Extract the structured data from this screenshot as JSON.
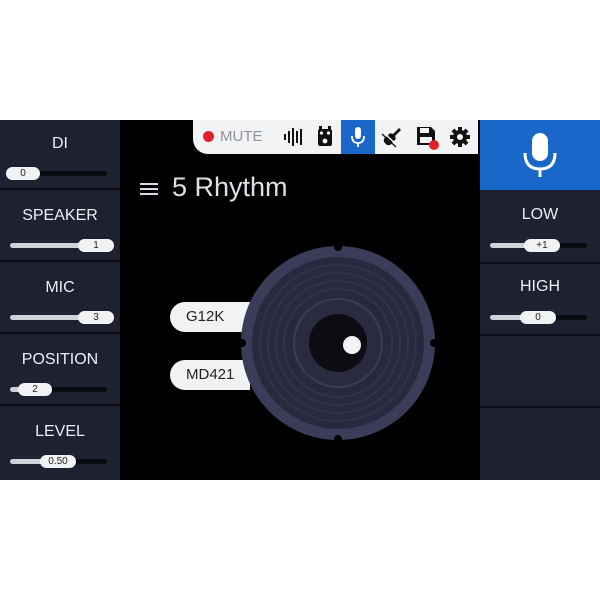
{
  "toolbar": {
    "mute_label": "MUTE",
    "icons": [
      "meter-icon",
      "pedal-icon",
      "microphone-icon",
      "guitar-icon",
      "save-icon",
      "gear-icon"
    ],
    "active_icon": "microphone-icon"
  },
  "preset": {
    "name": "5 Rhythm"
  },
  "left_params": [
    {
      "label": "DI",
      "value": "0",
      "level": 0.0
    },
    {
      "label": "SPEAKER",
      "value": "1",
      "level": 1.0
    },
    {
      "label": "MIC",
      "value": "3",
      "level": 1.0
    },
    {
      "label": "POSITION",
      "value": "2",
      "level": 0.25
    },
    {
      "label": "LEVEL",
      "value": "0.50",
      "level": 0.5
    }
  ],
  "right_params": [
    {
      "label": "LOW",
      "value": "+1",
      "level": 0.55
    },
    {
      "label": "HIGH",
      "value": "0",
      "level": 0.5
    }
  ],
  "speaker_model": "G12K",
  "mic_model": "MD421",
  "colors": {
    "accent": "#1967c9",
    "panel": "#1e2130",
    "mute": "#e0212b"
  }
}
